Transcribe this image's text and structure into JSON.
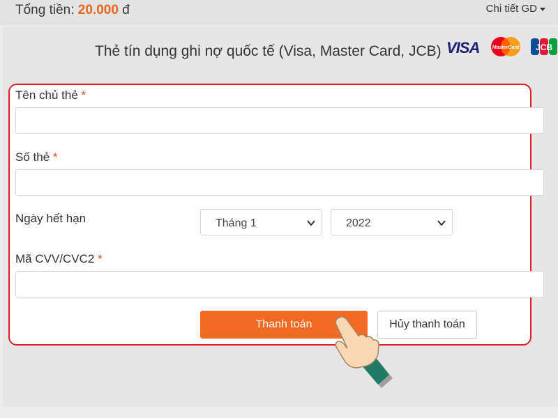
{
  "header": {
    "total_label": "Tổng tiền:",
    "total_amount": "20.000",
    "currency": "đ",
    "detail_link": "Chi tiết GD"
  },
  "card_section": {
    "title": "Thẻ tín dụng ghi nợ quốc tế (Visa, Master Card, JCB)",
    "logos": {
      "visa": "VISA",
      "mastercard": "MasterCard",
      "jcb": "JCB"
    }
  },
  "form": {
    "cardholder_label": "Tên chủ thẻ",
    "card_number_label": "Số thẻ",
    "expiry_label": "Ngày hết hạn",
    "cvv_label": "Mã CVV/CVC2",
    "required_mark": "*",
    "cardholder_value": "",
    "card_number_value": "",
    "cvv_value": "",
    "month_selected": "Tháng 1",
    "year_selected": "2022"
  },
  "actions": {
    "pay_label": "Thanh toán",
    "cancel_label": "Hủy thanh toán"
  },
  "colors": {
    "accent": "#f26b24",
    "highlight_border": "#e01e25",
    "amount": "#e8651e",
    "required": "#e8402a"
  },
  "icons": [
    "caret-down-icon",
    "visa-logo",
    "mastercard-logo",
    "jcb-logo",
    "chevron-down-icon",
    "pointing-hand-icon"
  ]
}
